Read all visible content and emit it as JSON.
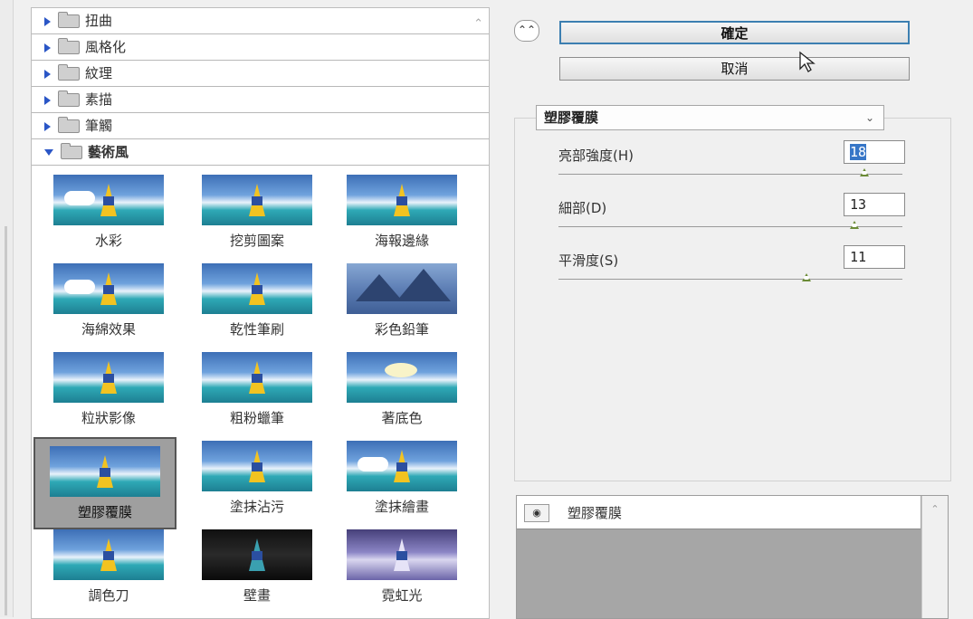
{
  "gallery": {
    "categories": [
      {
        "label": "扭曲"
      },
      {
        "label": "風格化"
      },
      {
        "label": "紋理"
      },
      {
        "label": "素描"
      },
      {
        "label": "筆觸"
      },
      {
        "label": "藝術風"
      }
    ],
    "thumbnails": [
      {
        "label": "水彩"
      },
      {
        "label": "挖剪圖案"
      },
      {
        "label": "海報邊緣"
      },
      {
        "label": "海綿效果"
      },
      {
        "label": "乾性筆刷"
      },
      {
        "label": "彩色鉛筆"
      },
      {
        "label": "粒狀影像"
      },
      {
        "label": "粗粉蠟筆"
      },
      {
        "label": "著底色"
      },
      {
        "label": "塑膠覆膜"
      },
      {
        "label": "塗抹沾污"
      },
      {
        "label": "塗抹繪畫"
      },
      {
        "label": "調色刀"
      },
      {
        "label": "壁畫"
      },
      {
        "label": "霓虹光"
      }
    ],
    "selected": "塑膠覆膜"
  },
  "buttons": {
    "ok": "確定",
    "cancel": "取消"
  },
  "settings": {
    "filter": "塑膠覆膜",
    "params": [
      {
        "label": "亮部強度(H)",
        "value": "18",
        "level": 0.89
      },
      {
        "label": "細部(D)",
        "value": "13",
        "level": 0.86
      },
      {
        "label": "平滑度(S)",
        "value": "11",
        "level": 0.72
      }
    ]
  },
  "layers": {
    "name": "塑膠覆膜"
  }
}
